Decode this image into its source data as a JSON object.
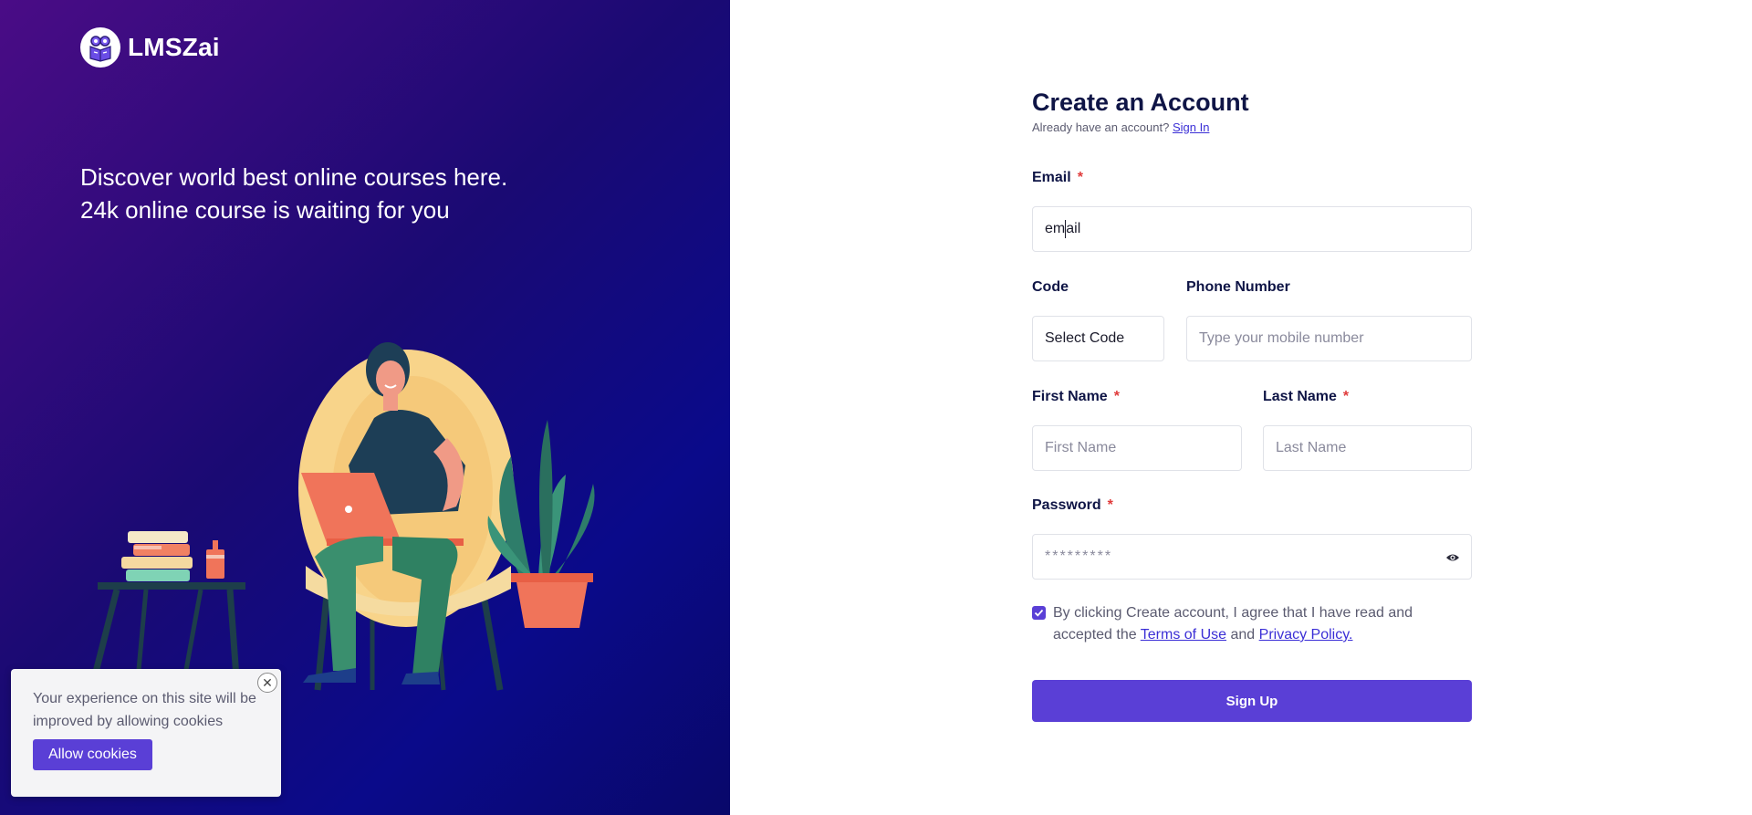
{
  "brand": {
    "name": "LMSZai"
  },
  "hero": {
    "tagline_line1": "Discover world best online courses here.",
    "tagline_line2": "24k online course is waiting for you"
  },
  "cookie": {
    "text": "Your experience on this site will be improved by allowing cookies",
    "button_label": "Allow cookies",
    "close_icon": "close-icon"
  },
  "form": {
    "title": "Create an Account",
    "already_text": "Already have an account?",
    "sign_in_link": "Sign In",
    "email": {
      "label": "Email",
      "required_mark": "*",
      "value_before_caret": "em",
      "value_after_caret": "ail"
    },
    "code": {
      "label": "Code",
      "value": "Select Code"
    },
    "phone": {
      "label": "Phone Number",
      "placeholder": "Type your mobile number"
    },
    "first_name": {
      "label": "First Name",
      "required_mark": "*",
      "placeholder": "First Name"
    },
    "last_name": {
      "label": "Last Name",
      "required_mark": "*",
      "placeholder": "Last Name"
    },
    "password": {
      "label": "Password",
      "required_mark": "*",
      "value": "*********",
      "toggle_icon": "eye-icon"
    },
    "agreement": {
      "checked": true,
      "text_before": "By clicking Create account, I agree that I have read and accepted the",
      "terms_link": "Terms of Use",
      "and_text": "and",
      "privacy_link": "Privacy Policy."
    },
    "submit_label": "Sign Up"
  },
  "colors": {
    "accent": "#5a3fd6",
    "heading": "#0f1546",
    "required": "#e03b3b",
    "hero_gradient_start": "#4a0c86",
    "hero_gradient_end": "#0a0a8a"
  }
}
